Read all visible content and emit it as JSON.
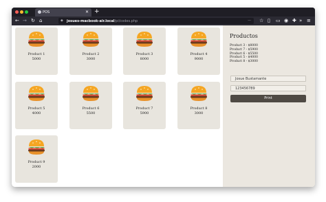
{
  "browser": {
    "tab_title": "POS",
    "tab_close": "✕",
    "new_tab": "+",
    "url_host": "josues-macbook-air.local",
    "url_path": "/pi/codes.php",
    "icons": [
      "back-icon",
      "forward-icon",
      "reload-icon",
      "home-icon",
      "shield-icon",
      "more-icon",
      "bookmark-icon",
      "extensions-icon",
      "menu-icon"
    ]
  },
  "colors": {
    "card_bg": "#e8e5de",
    "panel_bg": "#ebe7e0",
    "print_button": "#4f4a44"
  },
  "products": [
    {
      "name": "Product 1",
      "price": "5000"
    },
    {
      "name": "Product 2",
      "price": "3000"
    },
    {
      "name": "Product 3",
      "price": "8000"
    },
    {
      "name": "Product 4",
      "price": "9000"
    },
    {
      "name": "Product 5",
      "price": "4000"
    },
    {
      "name": "Product 6",
      "price": "5500"
    },
    {
      "name": "Product 7",
      "price": "5900"
    },
    {
      "name": "Product 8",
      "price": "3000"
    },
    {
      "name": "Product 9",
      "price": "2000"
    }
  ],
  "sidebar": {
    "title": "Productos",
    "cart_items": [
      "Product 3 - $8000",
      "Product 7 - $5900",
      "Product 6 - $5500",
      "Product 5 - $4000",
      "Product 8 - $3000"
    ],
    "customer_name": "Josue Bustamante",
    "customer_id": "123456789",
    "print_label": "Print"
  }
}
